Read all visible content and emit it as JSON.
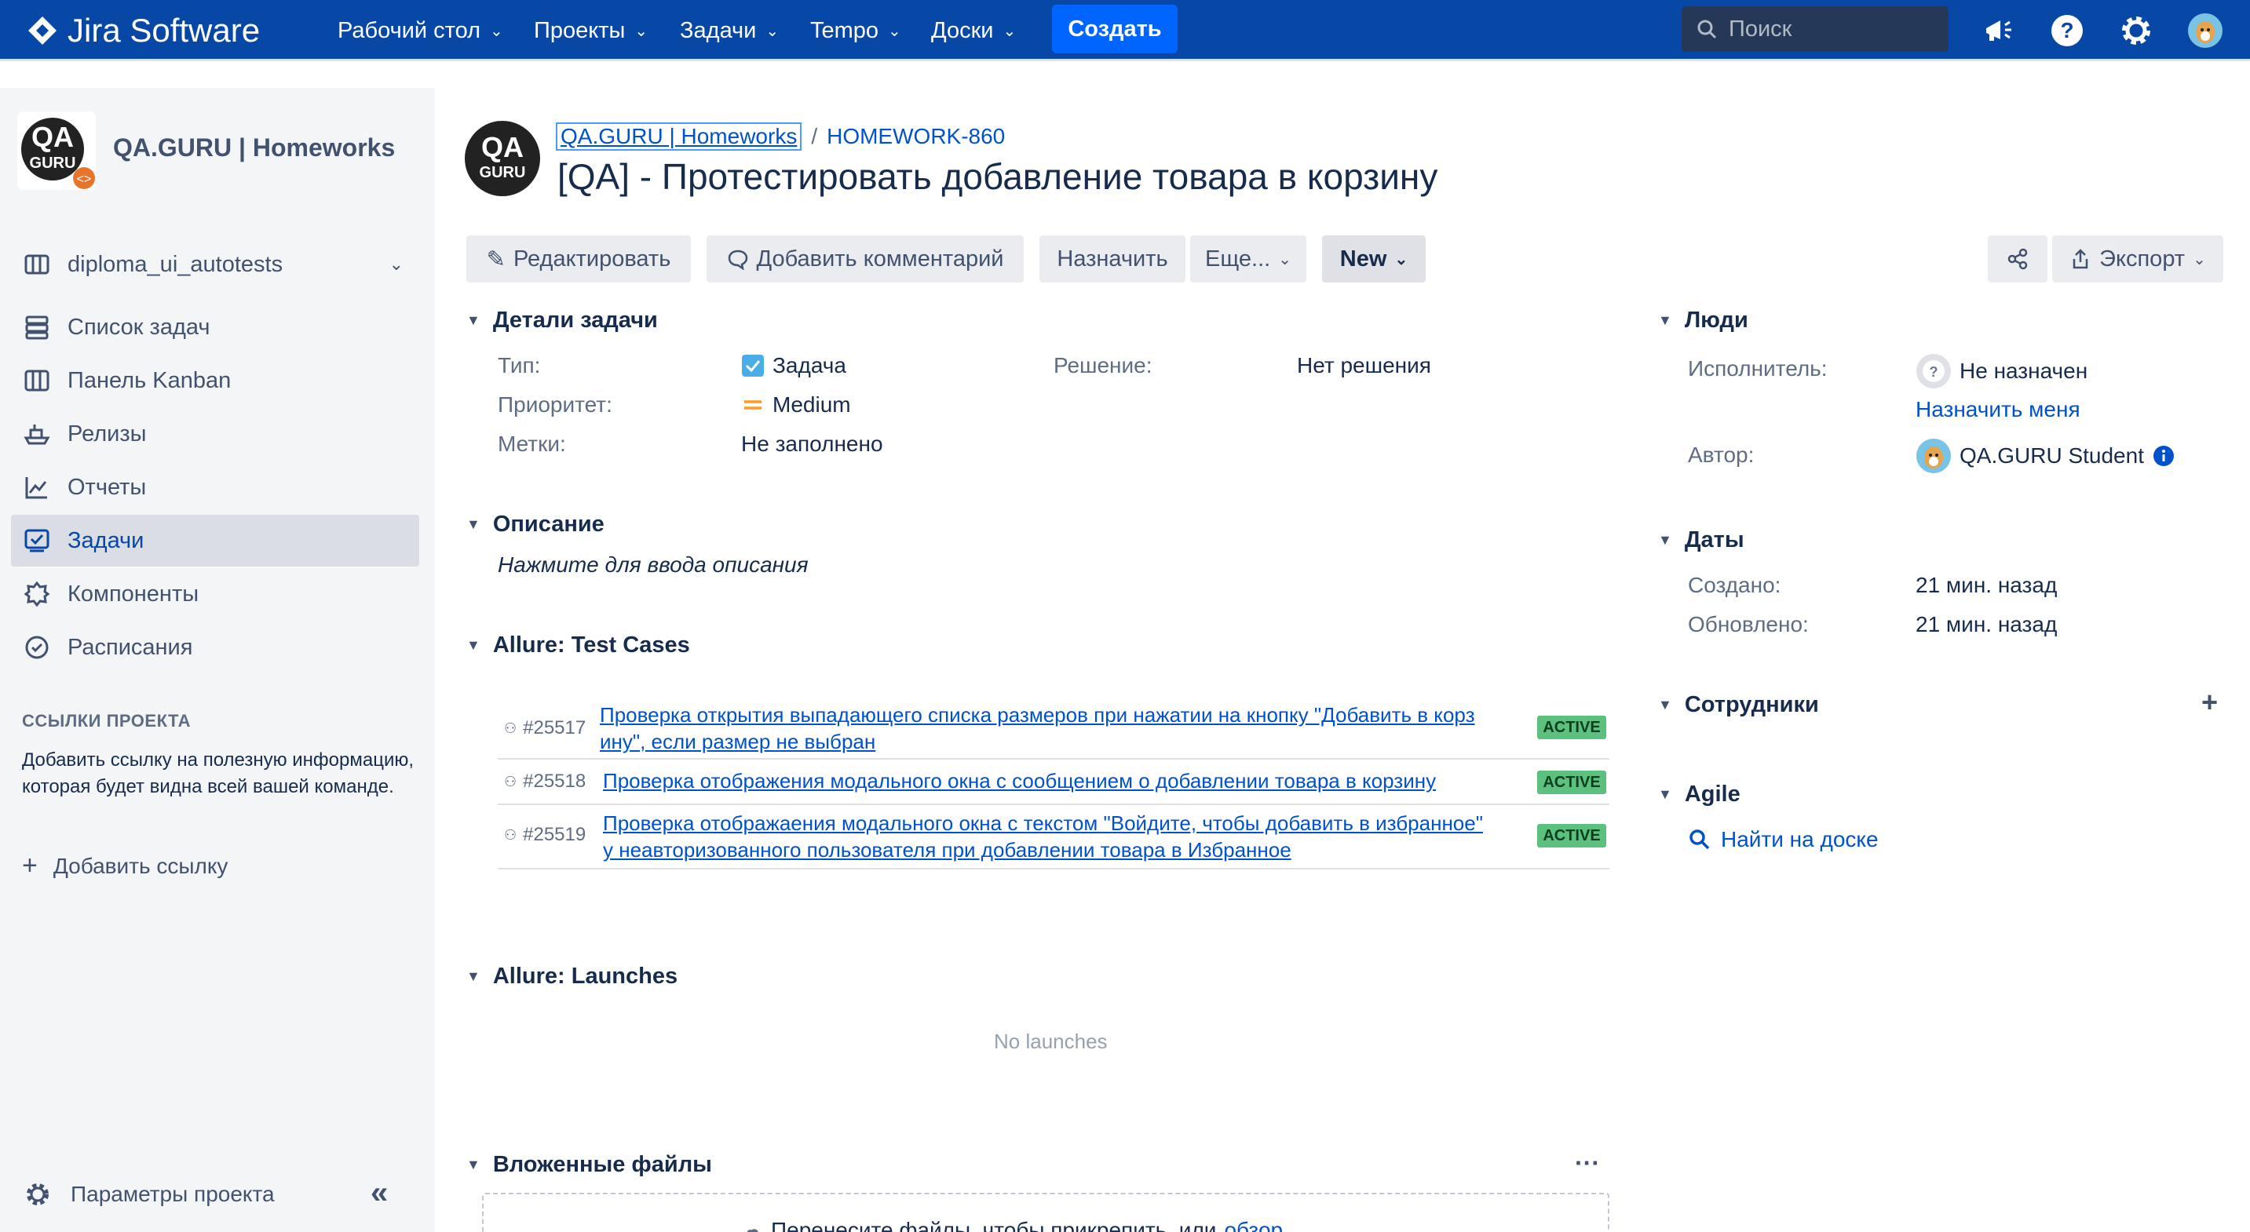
{
  "topnav": {
    "app_name": "Jira Software",
    "items": [
      {
        "label": "Рабочий стол"
      },
      {
        "label": "Проекты"
      },
      {
        "label": "Задачи"
      },
      {
        "label": "Tempo"
      },
      {
        "label": "Доски"
      }
    ],
    "create_label": "Создать",
    "search_placeholder": "Поиск"
  },
  "sidebar": {
    "project_name": "QA.GURU | Homeworks",
    "board_name": "diploma_ui_autotests",
    "items": [
      {
        "label": "Список задач",
        "icon": "backlog-icon"
      },
      {
        "label": "Панель Kanban",
        "icon": "kanban-icon"
      },
      {
        "label": "Релизы",
        "icon": "ship-icon"
      },
      {
        "label": "Отчеты",
        "icon": "reports-icon"
      },
      {
        "label": "Задачи",
        "icon": "issues-icon",
        "active": true
      },
      {
        "label": "Компоненты",
        "icon": "components-icon"
      },
      {
        "label": "Расписания",
        "icon": "schedule-icon"
      }
    ],
    "links_section": "ССЫЛКИ ПРОЕКТА",
    "links_text": "Добавить ссылку на полезную информацию, которая будет видна всей вашей команде.",
    "add_link_label": "Добавить ссылку",
    "settings_label": "Параметры проекта"
  },
  "issue": {
    "breadcrumb_project": "QA.GURU | Homeworks",
    "breadcrumb_key": "HOMEWORK-860",
    "title": "[QA] - Протестировать добавление товара в корзину"
  },
  "toolbar": {
    "edit": "Редактировать",
    "comment": "Добавить комментарий",
    "assign": "Назначить",
    "more": "Еще...",
    "status": "New",
    "export": "Экспорт"
  },
  "details": {
    "heading": "Детали задачи",
    "type_label": "Тип:",
    "type_value": "Задача",
    "priority_label": "Приоритет:",
    "priority_value": "Medium",
    "labels_label": "Метки:",
    "labels_value": "Не заполнено",
    "resolution_label": "Решение:",
    "resolution_value": "Нет решения"
  },
  "description": {
    "heading": "Описание",
    "placeholder": "Нажмите для ввода описания"
  },
  "allure_tc": {
    "heading": "Allure: Test Cases",
    "rows": [
      {
        "id": "#25517",
        "text1": "Проверка открытия выпадающего списка размеров при нажатии на кнопку \"Добавить в корз",
        "text2": "ину\", если размер не выбран",
        "status": "ACTIVE"
      },
      {
        "id": "#25518",
        "text1": "Проверка отображения модального окна с сообщением о добавлении товара в корзину",
        "text2": "",
        "status": "ACTIVE"
      },
      {
        "id": "#25519",
        "text1": "Проверка отображаения модального окна с текстом \"Войдите, чтобы добавить в избранное\"",
        "text2": "у неавторизованного пользователя при добавлении товара в Избранное",
        "status": "ACTIVE"
      }
    ]
  },
  "allure_launches": {
    "heading": "Allure: Launches",
    "empty": "No launches"
  },
  "attachments": {
    "heading": "Вложенные файлы",
    "drop_text": "Перенесите файлы, чтобы прикрепить, или",
    "browse": "обзор"
  },
  "people": {
    "heading": "Люди",
    "assignee_label": "Исполнитель:",
    "assignee_value": "Не назначен",
    "assign_me": "Назначить меня",
    "reporter_label": "Автор:",
    "reporter_value": "QA.GURU Student"
  },
  "dates": {
    "heading": "Даты",
    "created_label": "Создано:",
    "created_value": "21 мин. назад",
    "updated_label": "Обновлено:",
    "updated_value": "21 мин. назад"
  },
  "staff": {
    "heading": "Сотрудники"
  },
  "agile": {
    "heading": "Agile",
    "find_on_board": "Найти на доске"
  },
  "colors": {
    "nav_bg": "#0747a6",
    "create_btn": "#0065ff",
    "link": "#0052cc",
    "badge": "#5cc07e"
  }
}
